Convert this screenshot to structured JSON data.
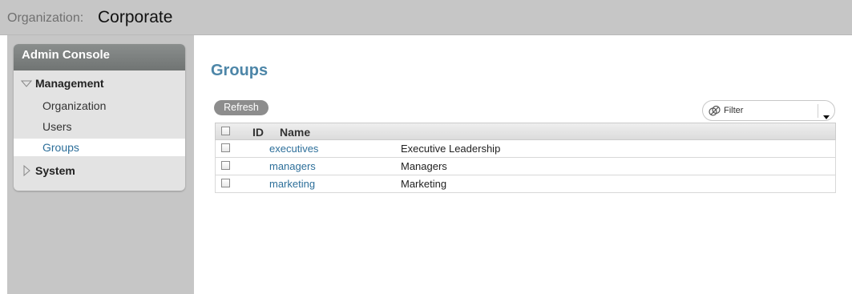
{
  "header": {
    "org_label": "Organization:",
    "org_value": "Corporate"
  },
  "sidebar": {
    "title": "Admin Console",
    "sections": [
      {
        "label": "Management",
        "expanded": true,
        "items": [
          {
            "label": "Organization",
            "active": false
          },
          {
            "label": "Users",
            "active": false
          },
          {
            "label": "Groups",
            "active": true
          }
        ]
      },
      {
        "label": "System",
        "expanded": false,
        "items": []
      }
    ]
  },
  "main": {
    "title": "Groups",
    "refresh_label": "Refresh",
    "filter": {
      "placeholder": "Filter"
    },
    "table": {
      "columns": [
        "ID",
        "Name"
      ],
      "rows": [
        {
          "id": "executives",
          "name": "Executive Leadership"
        },
        {
          "id": "managers",
          "name": "Managers"
        },
        {
          "id": "marketing",
          "name": "Marketing"
        }
      ]
    }
  },
  "colors": {
    "accent": "#4d86a8",
    "link": "#2d6f9a",
    "topbar": "#c6c6c6",
    "panel_header": "#7b7f7e"
  },
  "icons": {
    "expanded": "triangle-down-icon",
    "collapsed": "triangle-right-icon",
    "filter": "filter-icon",
    "dropdown": "caret-down-icon"
  }
}
